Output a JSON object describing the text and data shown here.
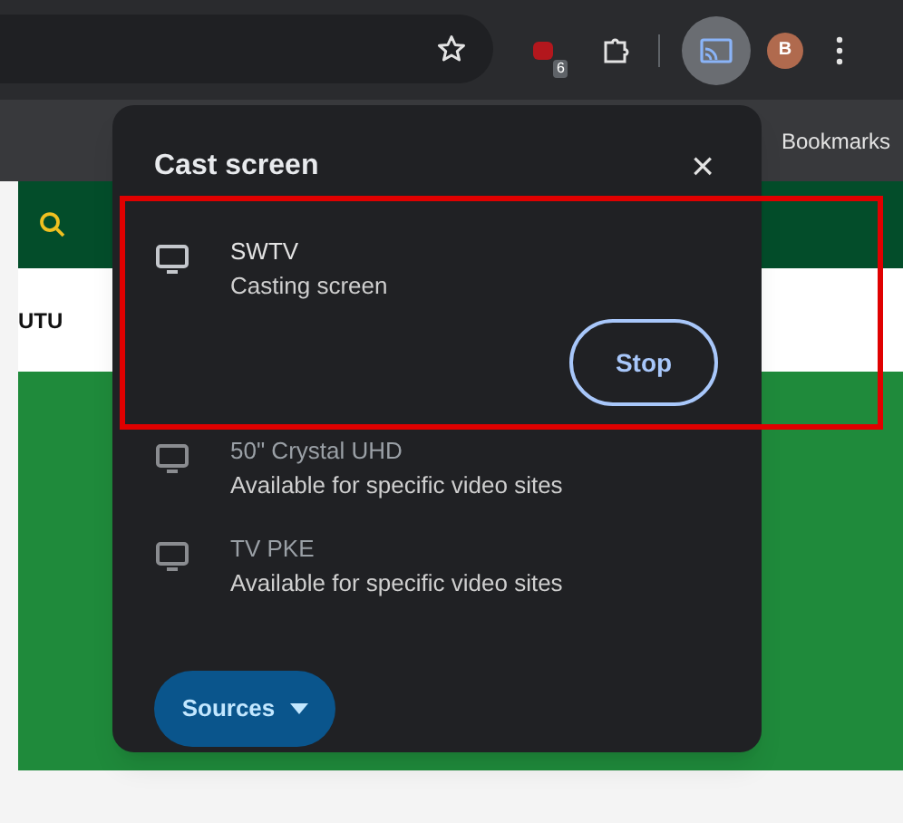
{
  "toolbar": {
    "extension_badge": "6",
    "avatar_letter": "B"
  },
  "bookmarks_bar": {
    "label": "Bookmarks"
  },
  "page": {
    "nav_text": "UTU"
  },
  "cast_dialog": {
    "title": "Cast screen",
    "close": "×",
    "devices": [
      {
        "name": "SWTV",
        "status": "Casting screen",
        "casting": true,
        "action": "Stop"
      },
      {
        "name": "50\" Crystal UHD",
        "status": "Available for specific video sites",
        "casting": false
      },
      {
        "name": "TV PKE",
        "status": "Available for specific video sites",
        "casting": false
      }
    ],
    "sources_button": "Sources"
  },
  "highlight": {
    "color": "#e00000"
  }
}
